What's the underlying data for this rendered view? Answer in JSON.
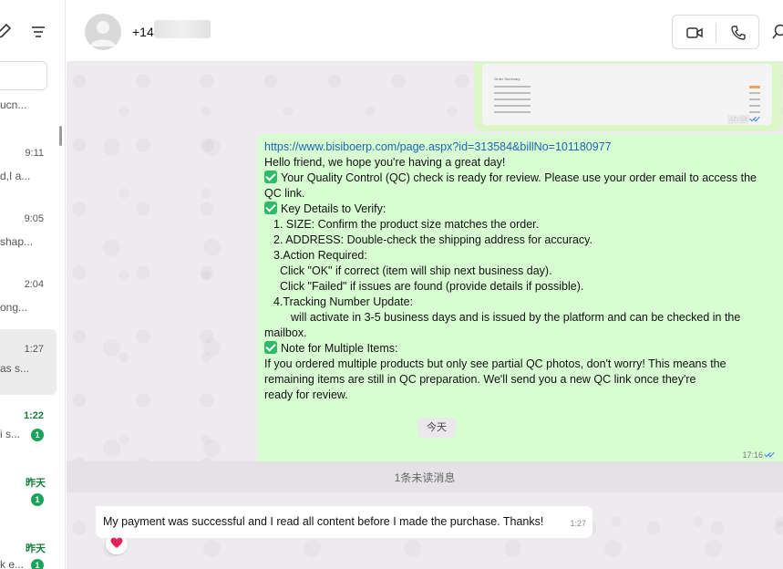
{
  "sidebar": {
    "chats": [
      {
        "time": "",
        "snippet": "ucn..."
      },
      {
        "time": "9:11",
        "snippet": "d,I a..."
      },
      {
        "time": "9:05",
        "snippet": "shap..."
      },
      {
        "time": "2:04",
        "snippet": "ong..."
      },
      {
        "time": "1:27",
        "snippet": "as s..."
      },
      {
        "time": "1:22",
        "snippet": "i s...",
        "unread": "1"
      },
      {
        "time": "昨天",
        "snippet": "",
        "unread": "1"
      },
      {
        "time": "昨天",
        "snippet": "k e...",
        "unread": "1"
      }
    ]
  },
  "header": {
    "contact_name": "+14"
  },
  "messages": {
    "image_time": "15:29",
    "image_doc_title": "Order Summary",
    "outgoing": {
      "link": "https://www.bisiboerp.com/page.aspx?id=313584&billNo=101180977",
      "lines": [
        "Hello friend, we hope you're having a great day!",
        "Your Quality Control (QC) check is ready for review. Please use your order email to access the",
        "QC link.",
        "Key Details to Verify:",
        "1. SIZE: Confirm the product size matches the order.",
        "2. ADDRESS: Double-check the shipping address for accuracy.",
        "3.Action Required:",
        "Click \"OK\" if correct (item will ship next business day).",
        "Click \"Failed\" if issues are found (provide details if possible).",
        "4.Tracking Number Update:",
        "will activate in 3-5 business days and is issued by the platform and can be checked in the",
        "mailbox.",
        "Note for Multiple Items:",
        "If you ordered multiple products but only see partial QC photos, don't worry! This means the",
        "remaining items are still in QC preparation. We'll send you a new QC link once they're",
        "ready for review."
      ],
      "time": "17:16"
    },
    "day_divider": "今天",
    "unread_divider": "1条未读消息",
    "incoming": {
      "text": "My payment was successful and I read all content before I made the purchase. Thanks!",
      "time": "1:27",
      "reaction": "❤️"
    }
  },
  "colors": {
    "outgoing_bubble": "#d9fdd3",
    "incoming_bubble": "#ffffff",
    "unread_badge": "#1aa35a",
    "link": "#1b67b1",
    "read_ticks": "#3b82f6"
  }
}
